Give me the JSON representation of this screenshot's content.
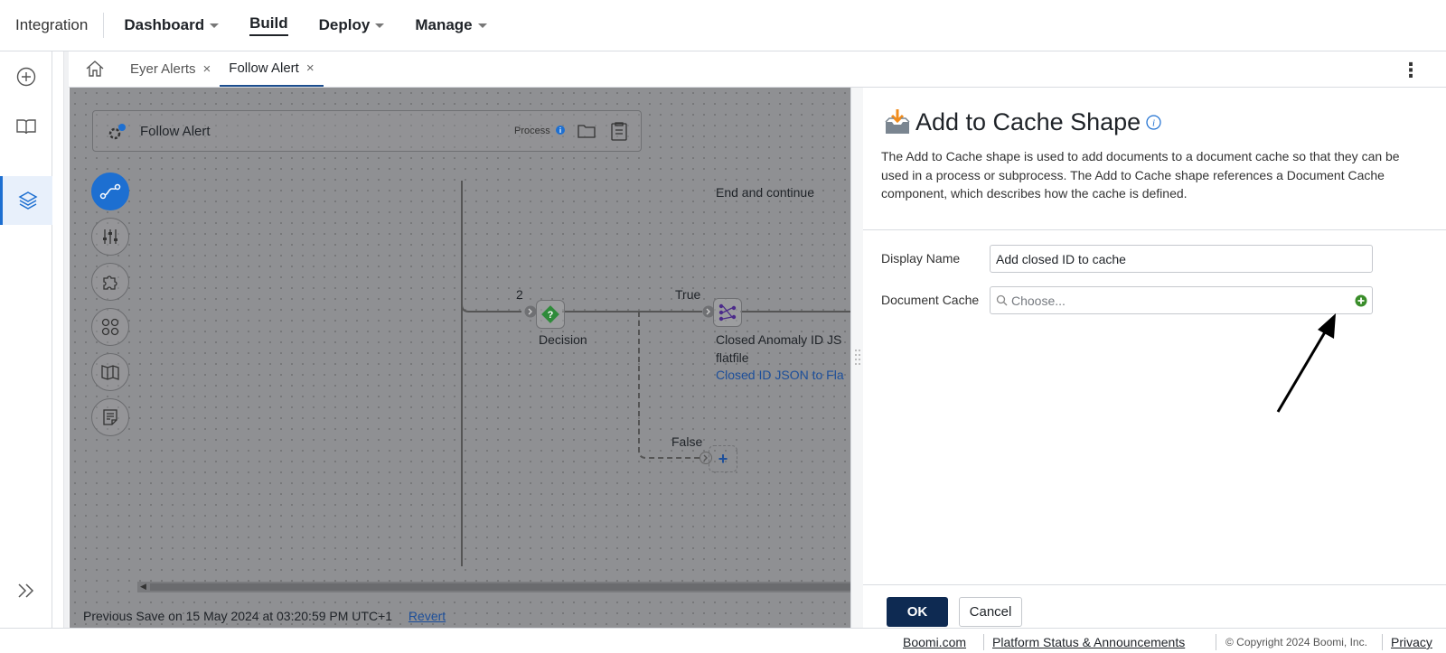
{
  "topnav": {
    "brand": "Integration",
    "items": [
      {
        "label": "Dashboard",
        "has_caret": true
      },
      {
        "label": "Build",
        "has_caret": false,
        "active": true
      },
      {
        "label": "Deploy",
        "has_caret": true
      },
      {
        "label": "Manage",
        "has_caret": true
      }
    ]
  },
  "rail": {
    "icons": [
      "plus-circle-icon",
      "book-icon",
      "layers-icon",
      "double-chevron-right-icon"
    ]
  },
  "tabs": {
    "items": [
      {
        "label": "Eyer Alerts",
        "close": "×"
      },
      {
        "label": "Follow Alert",
        "close": "×",
        "active": true
      }
    ],
    "menu_glyph": "⋮"
  },
  "process": {
    "title": "Follow Alert",
    "label": "Process"
  },
  "canvas": {
    "end_continue": "End and continue",
    "branch_count": "2",
    "decision_label": "Decision",
    "true_label": "True",
    "false_label": "False",
    "map_title_line1": "Closed Anomaly ID JS",
    "map_title_line2": "flatfile",
    "map_link": "Closed ID JSON to Fla",
    "add_glyph": "+"
  },
  "save_bar": {
    "text": "Previous Save on 15 May 2024 at 03:20:59 PM UTC+1",
    "revert": "Revert"
  },
  "panel": {
    "title": "Add to Cache Shape",
    "description": "The Add to Cache shape is used to add documents to a document cache so that they can be used in a process or subprocess. The Add to Cache shape references a Document Cache component, which describes how the cache is defined.",
    "display_name_label": "Display Name",
    "display_name_value": "Add closed ID to cache",
    "document_cache_label": "Document Cache",
    "document_cache_placeholder": "Choose...",
    "ok": "OK",
    "cancel": "Cancel"
  },
  "footer": {
    "boomi": "Boomi.com",
    "status": "Platform Status & Announcements",
    "copyright": "© Copyright 2024 Boomi, Inc.",
    "privacy": "Privacy"
  },
  "colors": {
    "accent": "#1d6fd1",
    "ok_button": "#0e2a52",
    "decision_green": "#2e8b3a",
    "add_green": "#3a8d2a",
    "cache_orange": "#f08c1c"
  }
}
